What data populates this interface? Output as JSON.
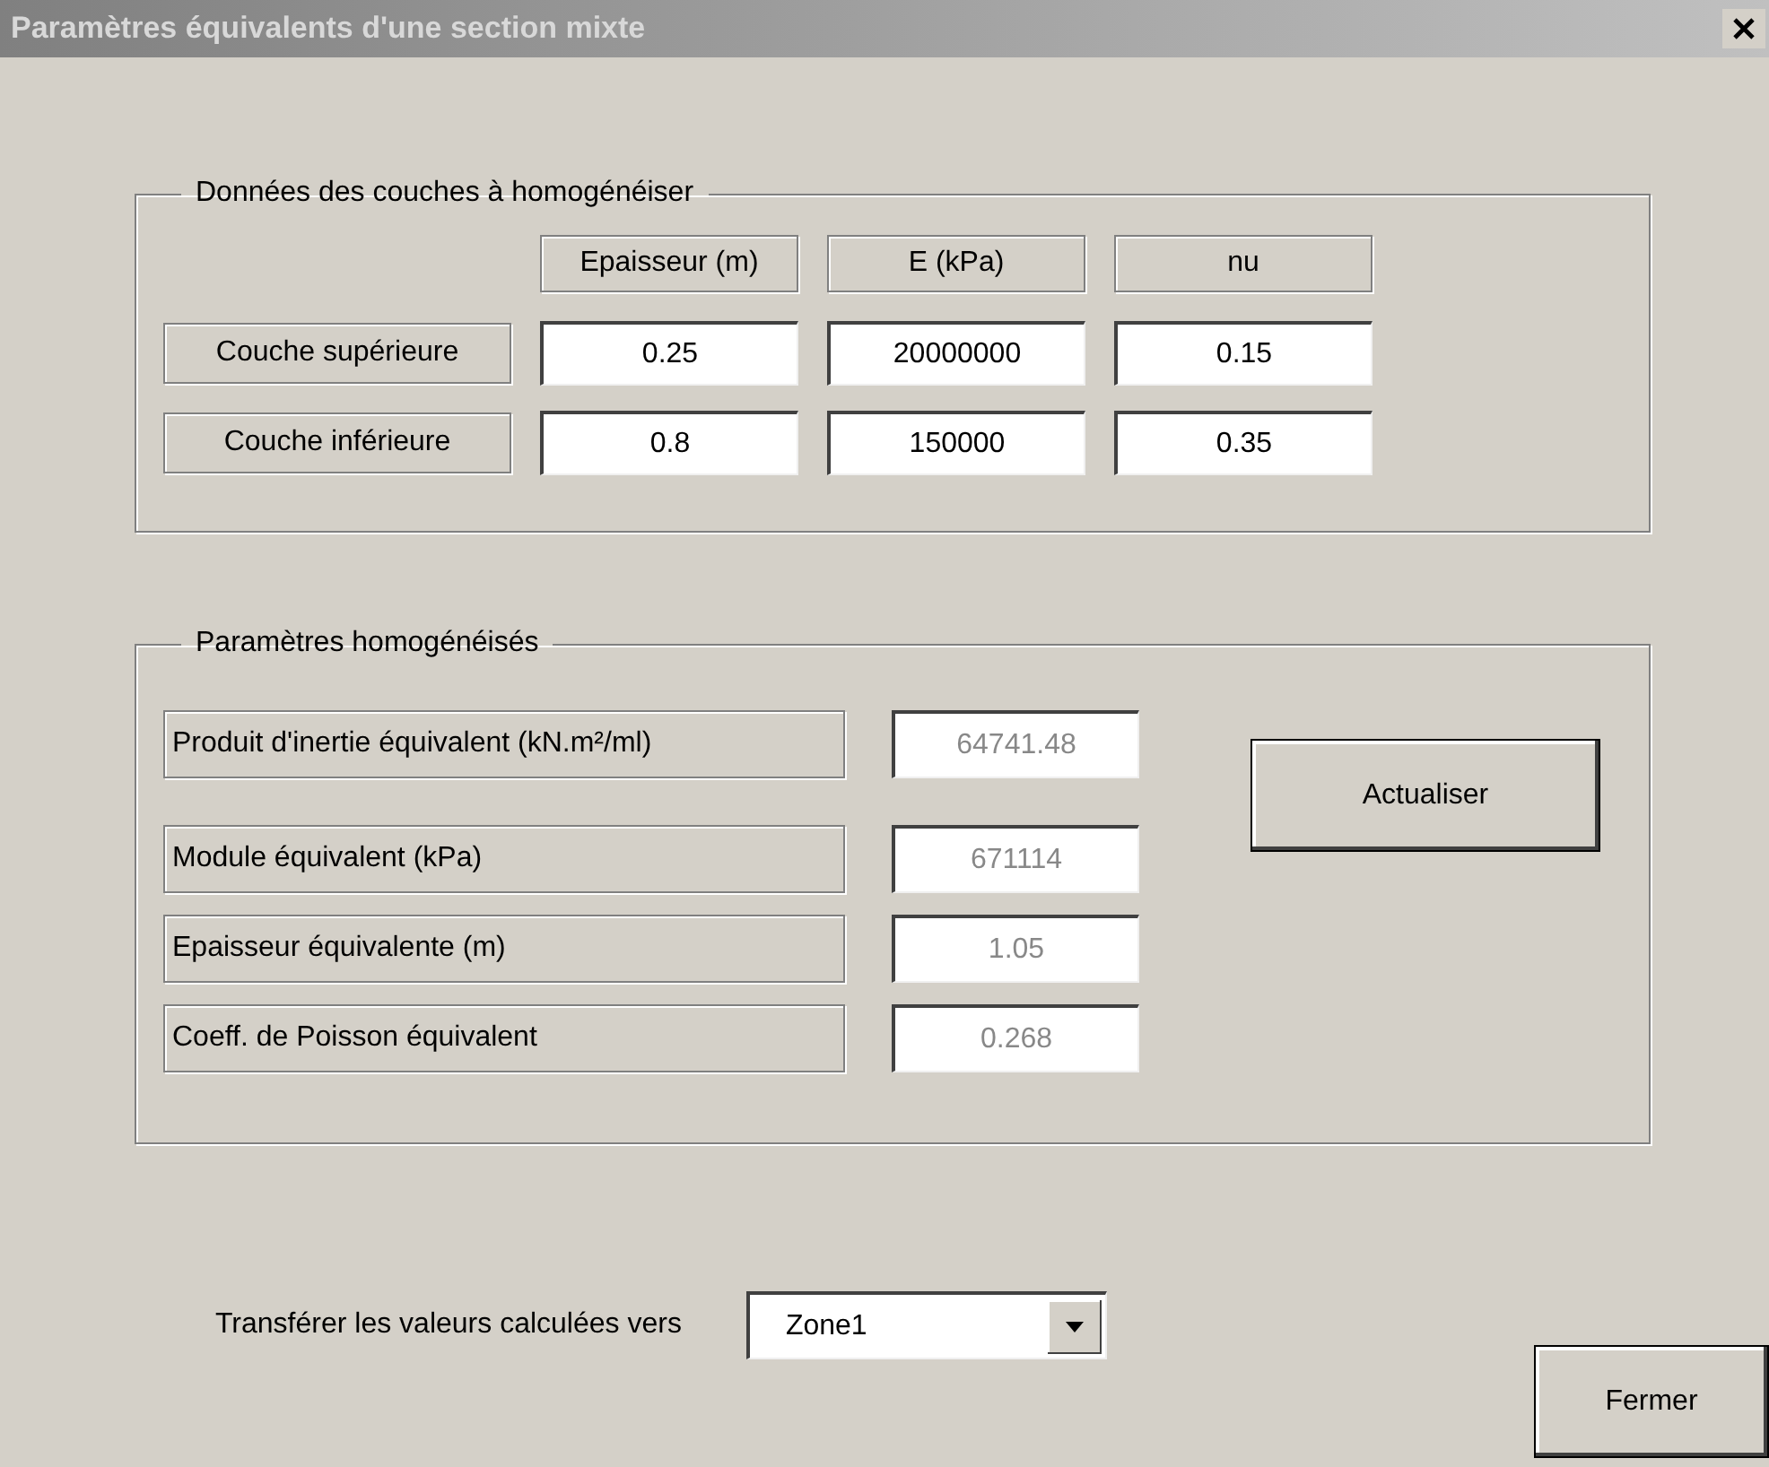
{
  "window": {
    "title": "Paramètres équivalents d'une section mixte"
  },
  "layers_group": {
    "legend": "Données des couches à homogénéiser",
    "columns": [
      "Epaisseur (m)",
      "E (kPa)",
      "nu"
    ],
    "rows": [
      {
        "label": "Couche supérieure",
        "values": [
          "0.25",
          "20000000",
          "0.15"
        ]
      },
      {
        "label": "Couche inférieure",
        "values": [
          "0.8",
          "150000",
          "0.35"
        ]
      }
    ]
  },
  "results_group": {
    "legend": "Paramètres homogénéisés",
    "rows": [
      {
        "label": "Produit d'inertie équivalent  (kN.m²/ml)",
        "value": "64741.48",
        "disabled": true
      },
      {
        "label": "Module équivalent  (kPa)",
        "value": "671114",
        "disabled": true
      },
      {
        "label": "Epaisseur équivalente  (m)",
        "value": "1.05",
        "disabled": true
      },
      {
        "label": "Coeff. de Poisson équivalent",
        "value": "0.268",
        "disabled": true
      }
    ],
    "update_button": "Actualiser"
  },
  "transfer": {
    "label": "Transférer les valeurs calculées vers",
    "value": "Zone1"
  },
  "close_button": "Fermer"
}
